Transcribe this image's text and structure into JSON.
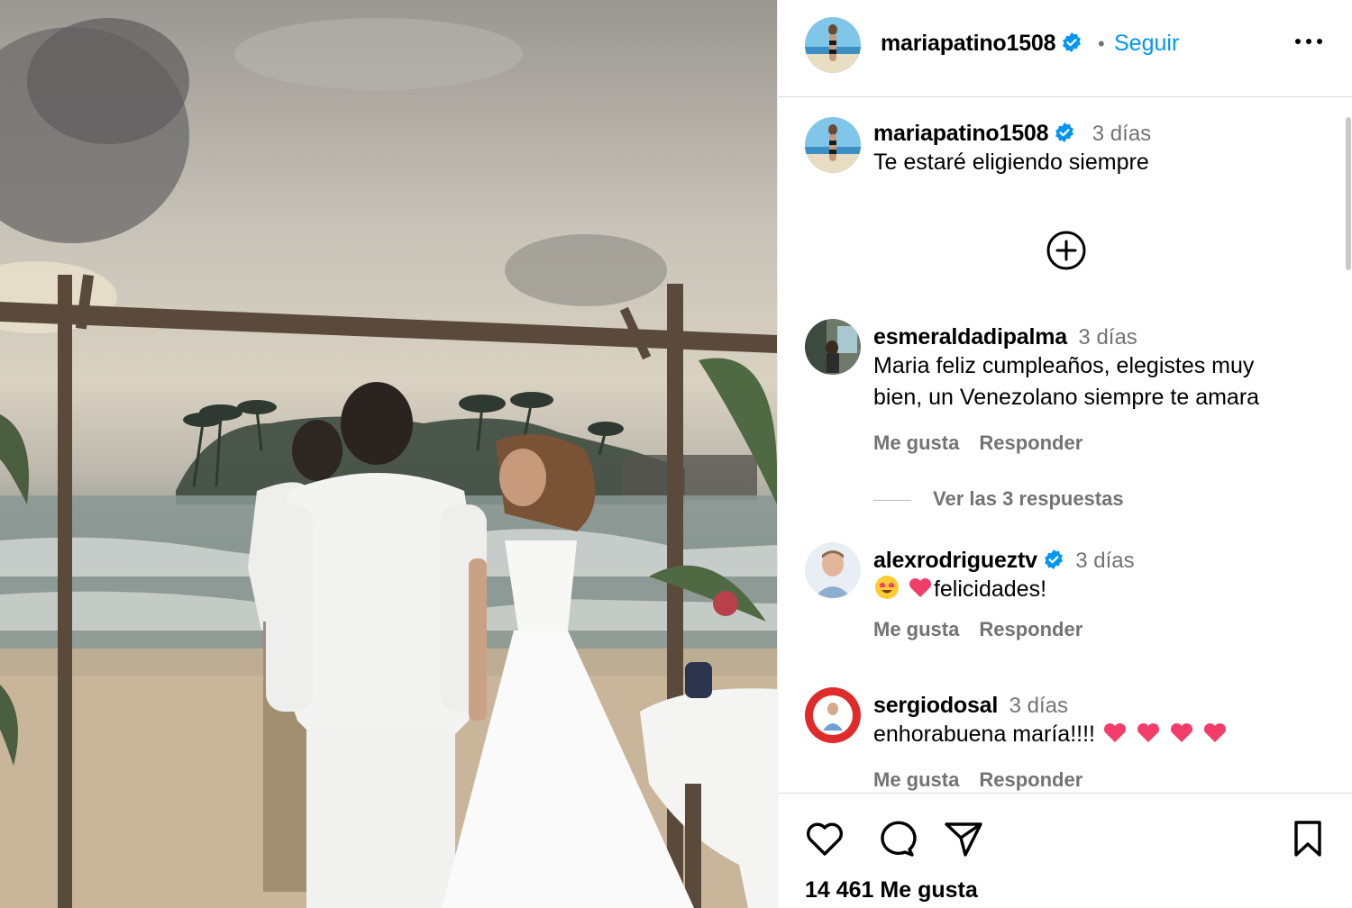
{
  "post": {
    "author": "mariapatino1508",
    "follow_label": "Seguir",
    "separator": "•",
    "caption": {
      "username": "mariapatino1508",
      "time": "3 días",
      "text": "Te estaré eligiendo siempre"
    }
  },
  "comments": [
    {
      "username": "esmeraldadipalma",
      "time": "3 días",
      "text_line1": "Maria feliz cumpleaños, elegistes muy",
      "text_line2": "bien, un Venezolano siempre te amara",
      "like_label": "Me gusta",
      "reply_label": "Responder",
      "view_replies": "Ver las 3 respuestas"
    },
    {
      "username": "alexrodrigueztv",
      "time": "3 días",
      "text": "felicidades!",
      "emojis": [
        "heart-eyes-emoji",
        "pink-heart-emoji"
      ],
      "like_label": "Me gusta",
      "reply_label": "Responder"
    },
    {
      "username": "sergiodosal",
      "time": "3 días",
      "text": "enhorabuena maría!!!!",
      "emojis": [
        "pink-heart-emoji",
        "pink-heart-emoji",
        "pink-heart-emoji",
        "pink-heart-emoji"
      ],
      "like_label": "Me gusta",
      "reply_label": "Responder"
    }
  ],
  "footer": {
    "likes_text": "14 461 Me gusta",
    "icons": [
      "heart-icon",
      "comment-icon",
      "share-icon",
      "save-icon"
    ]
  },
  "colors": {
    "link_blue": "#0095f6",
    "muted_gray": "#737373",
    "verified_blue": "#0095f6",
    "emoji_heart": "#f23d6b"
  }
}
